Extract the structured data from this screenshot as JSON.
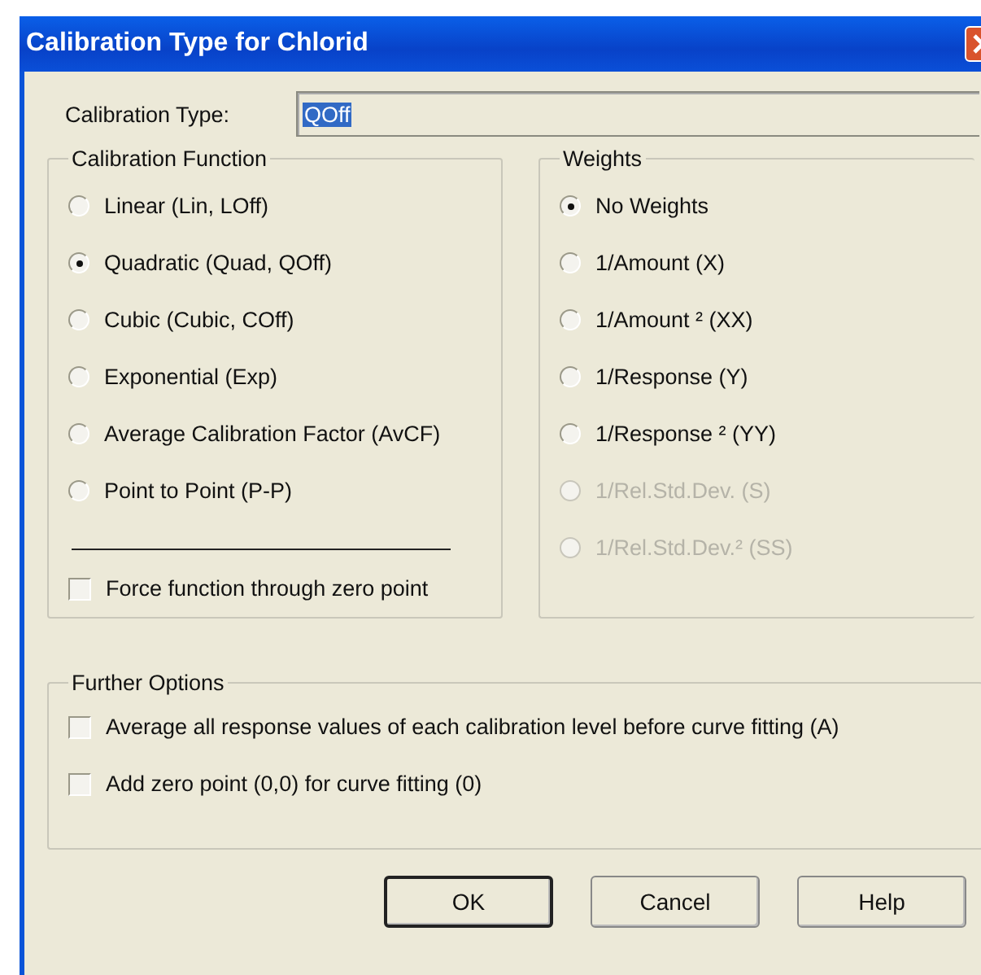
{
  "window": {
    "title": "Calibration Type for Chlorid"
  },
  "calibration_type": {
    "label": "Calibration Type:",
    "value": "QOff"
  },
  "calibration_function": {
    "title": "Calibration Function",
    "options": [
      {
        "label": "Linear (Lin, LOff)",
        "selected": false
      },
      {
        "label": "Quadratic (Quad, QOff)",
        "selected": true
      },
      {
        "label": "Cubic (Cubic, COff)",
        "selected": false
      },
      {
        "label": "Exponential (Exp)",
        "selected": false
      },
      {
        "label": "Average Calibration Factor (AvCF)",
        "selected": false
      },
      {
        "label": "Point to Point (P-P)",
        "selected": false
      }
    ],
    "force_zero": {
      "label": "Force function through zero point",
      "checked": false
    }
  },
  "weights": {
    "title": "Weights",
    "options": [
      {
        "label": "No Weights",
        "selected": true,
        "disabled": false
      },
      {
        "label": "1/Amount (X)",
        "selected": false,
        "disabled": false
      },
      {
        "label": "1/Amount ² (XX)",
        "selected": false,
        "disabled": false
      },
      {
        "label": "1/Response (Y)",
        "selected": false,
        "disabled": false
      },
      {
        "label": "1/Response ² (YY)",
        "selected": false,
        "disabled": false
      },
      {
        "label": "1/Rel.Std.Dev. (S)",
        "selected": false,
        "disabled": true
      },
      {
        "label": "1/Rel.Std.Dev.² (SS)",
        "selected": false,
        "disabled": true
      }
    ]
  },
  "further_options": {
    "title": "Further Options",
    "options": [
      {
        "label": "Average all response values of each calibration level before curve fitting (A)",
        "checked": false
      },
      {
        "label": "Add zero point (0,0) for curve fitting (0)",
        "checked": false
      }
    ]
  },
  "buttons": [
    {
      "label": "OK",
      "default": true
    },
    {
      "label": "Cancel",
      "default": false
    },
    {
      "label": "Help",
      "default": false
    }
  ]
}
